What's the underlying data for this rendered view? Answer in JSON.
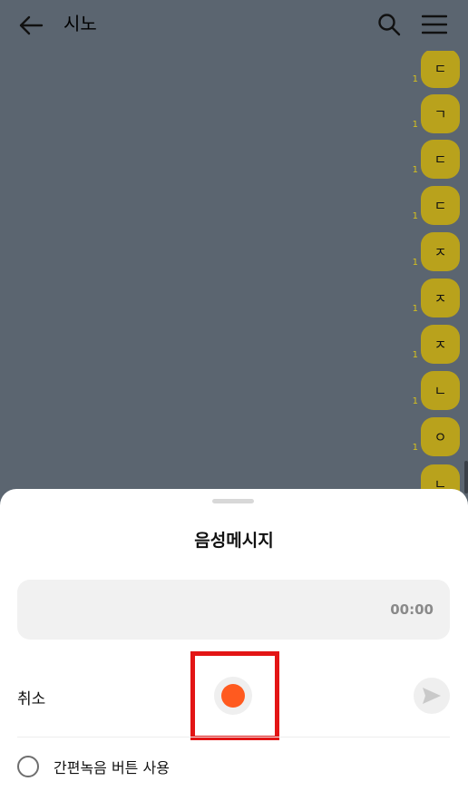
{
  "header": {
    "title": "시노",
    "back_icon": "arrow-left-icon",
    "search_icon": "search-icon",
    "menu_icon": "hamburger-menu-icon"
  },
  "messages": [
    {
      "text": "ㄷ",
      "count": "1"
    },
    {
      "text": "ㄱ",
      "count": "1"
    },
    {
      "text": "ㄷ",
      "count": "1"
    },
    {
      "text": "ㄷ",
      "count": "1"
    },
    {
      "text": "ㅈ",
      "count": "1"
    },
    {
      "text": "ㅈ",
      "count": "1"
    },
    {
      "text": "ㅈ",
      "count": "1"
    },
    {
      "text": "ㄴ",
      "count": "1"
    },
    {
      "text": "ㅇ",
      "count": "1"
    },
    {
      "text": "ㄴ",
      "count": ""
    }
  ],
  "colors": {
    "chat_bg": "#5b6570",
    "bubble": "#b9a21c",
    "record": "#ff5a1f",
    "highlight": "#e31515"
  },
  "voice_sheet": {
    "title": "음성메시지",
    "timer": "00:00",
    "cancel_label": "취소",
    "record_icon": "record-icon",
    "send_icon": "send-icon",
    "easy_record_label": "간편녹음 버튼 사용"
  }
}
